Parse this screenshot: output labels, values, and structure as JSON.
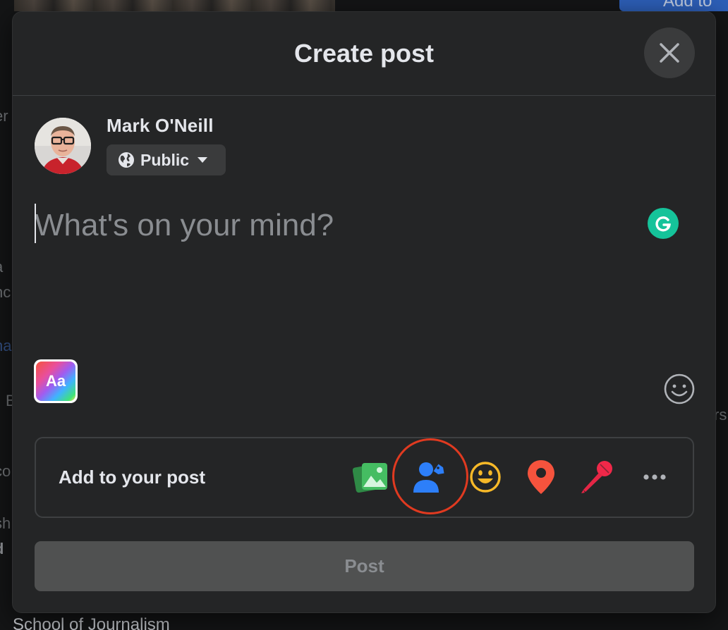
{
  "background": {
    "add_button_label": "Add to",
    "bottom_text": "School of Journalism",
    "left_fragments": [
      "er",
      "a",
      "nc",
      "na",
      "B",
      "co",
      "sh",
      "d"
    ],
    "right_fragments": [
      "rs"
    ]
  },
  "modal": {
    "title": "Create post",
    "close_icon": "close-icon"
  },
  "user": {
    "name": "Mark O'Neill",
    "privacy": "Public",
    "privacy_icon": "globe-icon"
  },
  "composer": {
    "placeholder": "What's on your mind?",
    "value": ""
  },
  "text_style_button": {
    "label": "Aa"
  },
  "add_to_post": {
    "label": "Add to your post",
    "items": [
      {
        "name": "photo-video",
        "icon": "photo-icon",
        "color": "#45bd62"
      },
      {
        "name": "tag-people",
        "icon": "tag-people-icon",
        "color": "#1877f2",
        "highlighted": true
      },
      {
        "name": "feeling-activity",
        "icon": "smiley-icon",
        "color": "#f7b928"
      },
      {
        "name": "check-in",
        "icon": "location-pin-icon",
        "color": "#f5533d"
      },
      {
        "name": "host-qa",
        "icon": "microphone-icon",
        "color": "#e42645"
      },
      {
        "name": "more",
        "icon": "more-icon",
        "color": "#b0b3b8"
      }
    ],
    "highlight_color": "#e03a20"
  },
  "post_button": {
    "label": "Post",
    "disabled": true
  }
}
